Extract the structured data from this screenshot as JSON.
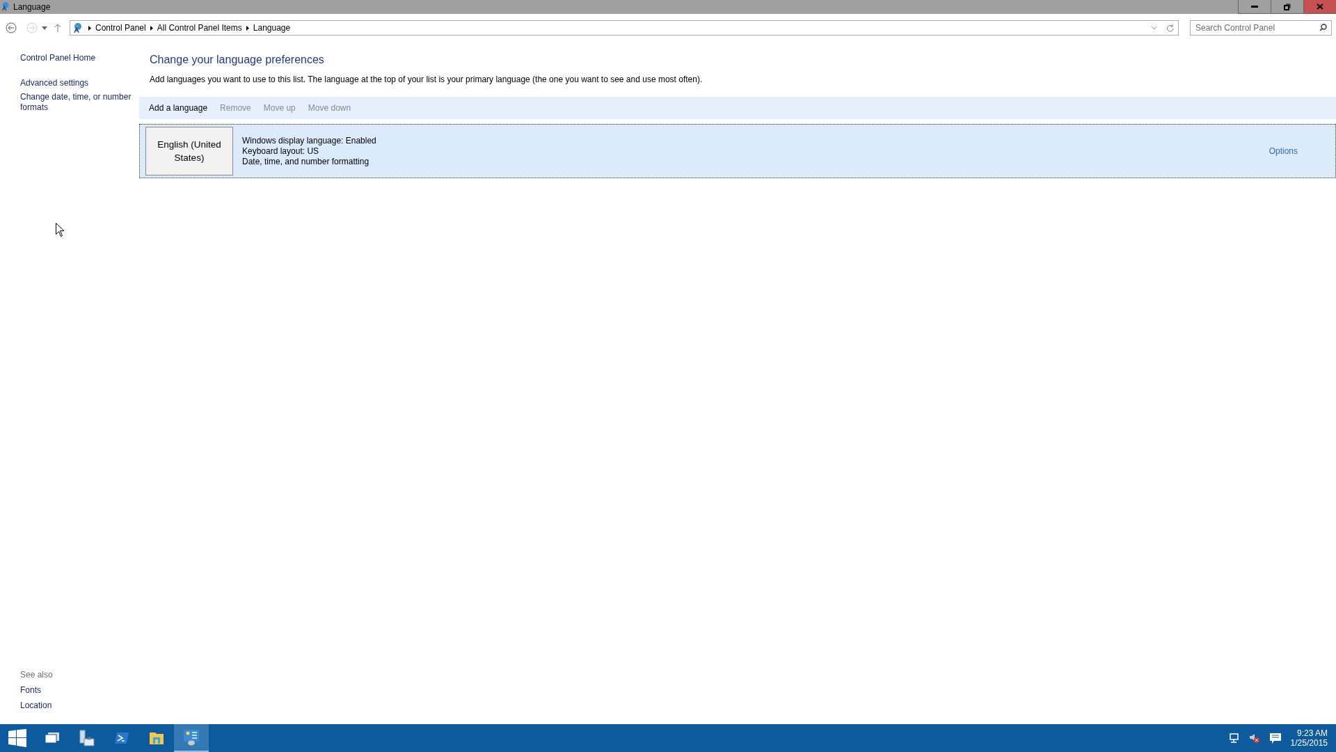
{
  "window": {
    "title": "Language"
  },
  "address_bar": {
    "breadcrumbs": [
      "Control Panel",
      "All Control Panel Items",
      "Language"
    ]
  },
  "search": {
    "placeholder": "Search Control Panel"
  },
  "sidebar": {
    "links": [
      "Control Panel Home",
      "Advanced settings",
      "Change date, time, or number formats"
    ],
    "see_also": {
      "title": "See also",
      "links": [
        "Fonts",
        "Location"
      ]
    }
  },
  "main": {
    "heading": "Change your language preferences",
    "description": "Add languages you want to use to this list. The language at the top of your list is your primary language (the one you want to see and use most often).",
    "toolbar": [
      {
        "label": "Add a language",
        "disabled": false
      },
      {
        "label": "Remove",
        "disabled": true
      },
      {
        "label": "Move up",
        "disabled": true
      },
      {
        "label": "Move down",
        "disabled": true
      }
    ],
    "languages": [
      {
        "name": "English (United States)",
        "details": [
          "Windows display language: Enabled",
          "Keyboard layout: US",
          "Date, time, and number formatting"
        ],
        "options": "Options",
        "selected": true
      }
    ]
  },
  "taskbar": {
    "apps": [
      {
        "kind": "start",
        "selected": false
      },
      {
        "kind": "taskview",
        "selected": false
      },
      {
        "kind": "server",
        "selected": false
      },
      {
        "kind": "powershell",
        "selected": false
      },
      {
        "kind": "explorer",
        "selected": false
      },
      {
        "kind": "controlpanel",
        "selected": true
      }
    ],
    "clock": {
      "time": "9:23 AM",
      "date": "1/25/2015"
    }
  }
}
